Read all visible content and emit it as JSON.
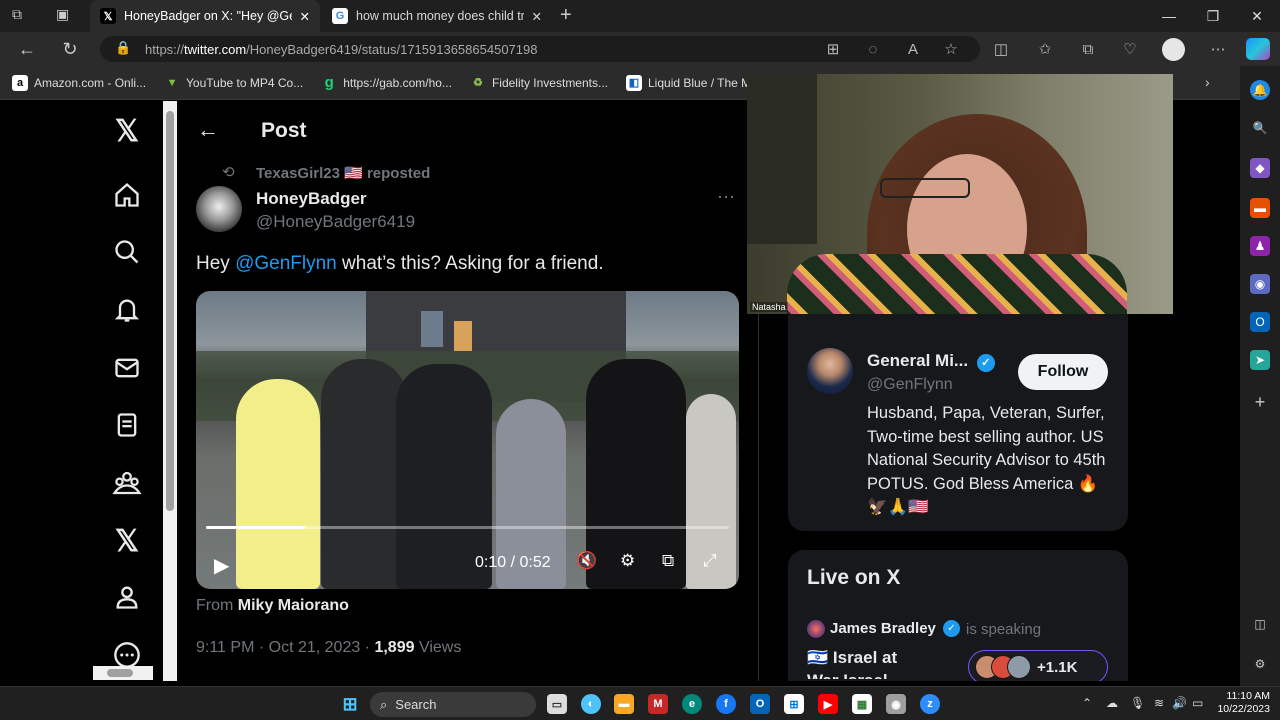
{
  "browser": {
    "tabs": [
      {
        "title": "HoneyBadger on X: \"Hey @GenF",
        "favicon": "x-logo",
        "active": true
      },
      {
        "title": "how much money does child traf",
        "favicon": "google-logo",
        "active": false
      }
    ],
    "url_prefix": "https://",
    "url_host": "twitter.com",
    "url_path": "/HoneyBadger6419/status/1715913658654507198",
    "bookmarks": [
      {
        "label": "Amazon.com - Onli...",
        "icon": "amazon-icon"
      },
      {
        "label": "YouTube to MP4 Co...",
        "icon": "youtube-mp4-icon"
      },
      {
        "label": "https://gab.com/ho...",
        "icon": "gab-icon"
      },
      {
        "label": "Fidelity Investments...",
        "icon": "fidelity-icon"
      },
      {
        "label": "Liquid Blue / The M...",
        "icon": "liquid-blue-icon"
      }
    ]
  },
  "nav": {
    "header": "Post"
  },
  "post": {
    "repost_by": "TexasGirl23 🇺🇸 reposted",
    "author_name": "HoneyBadger",
    "author_handle": "@HoneyBadger6419",
    "text_prefix": "Hey ",
    "mention": "@GenFlynn",
    "text_suffix": " what’s this? Asking for a friend.",
    "video": {
      "time": "0:10 / 0:52",
      "progress": 0.19
    },
    "from_label": "From ",
    "from_name": "Miky Maiorano",
    "timestamp": "9:11 PM · Oct 21, 2023 · ",
    "views_count": "1,899",
    "views_label": " Views"
  },
  "sidebar": {
    "profile": {
      "name": "General Mi...",
      "handle": "@GenFlynn",
      "follow_label": "Follow",
      "bio": "Husband, Papa, Veteran, Surfer, Two-time best selling author. US National Security Advisor to 45th POTUS. God Bless America 🔥🦅🙏🇺🇸"
    },
    "live": {
      "title": "Live on X",
      "host": "James Bradley",
      "status": "is speaking",
      "space_title": "Israel at",
      "space_title2": "War Israel",
      "listeners": "+1.1K"
    }
  },
  "webcam": {
    "label": "Natasha"
  },
  "taskbar": {
    "search_label": "Search",
    "time": "11:10 AM",
    "date": "10/22/2023"
  }
}
